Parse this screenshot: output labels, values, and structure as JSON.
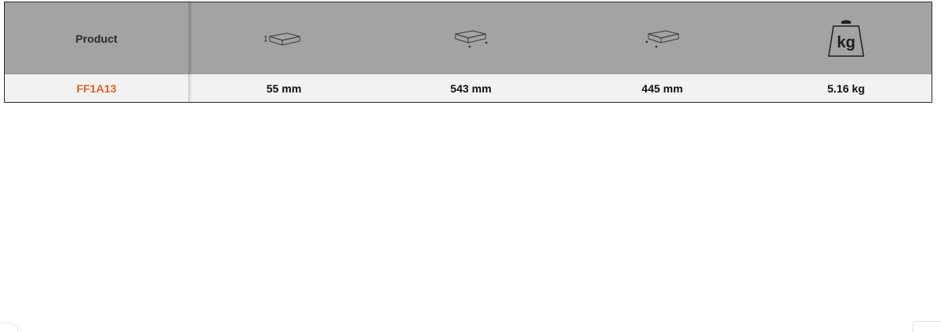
{
  "table": {
    "header": {
      "product_label": "Product",
      "columns": [
        {
          "icon": "box-height-icon"
        },
        {
          "icon": "box-length-icon"
        },
        {
          "icon": "box-width-icon"
        },
        {
          "icon": "weight-kg-icon",
          "icon_text": "kg"
        }
      ]
    },
    "rows": [
      {
        "product": "FF1A13",
        "height": "55 mm",
        "length": "543 mm",
        "width": "445 mm",
        "weight": "5.16 kg"
      }
    ]
  },
  "colors": {
    "header_bg": "#a3a3a3",
    "row_bg": "#f2f2f2",
    "accent": "#e2631d",
    "border": "#2b2b2b"
  }
}
